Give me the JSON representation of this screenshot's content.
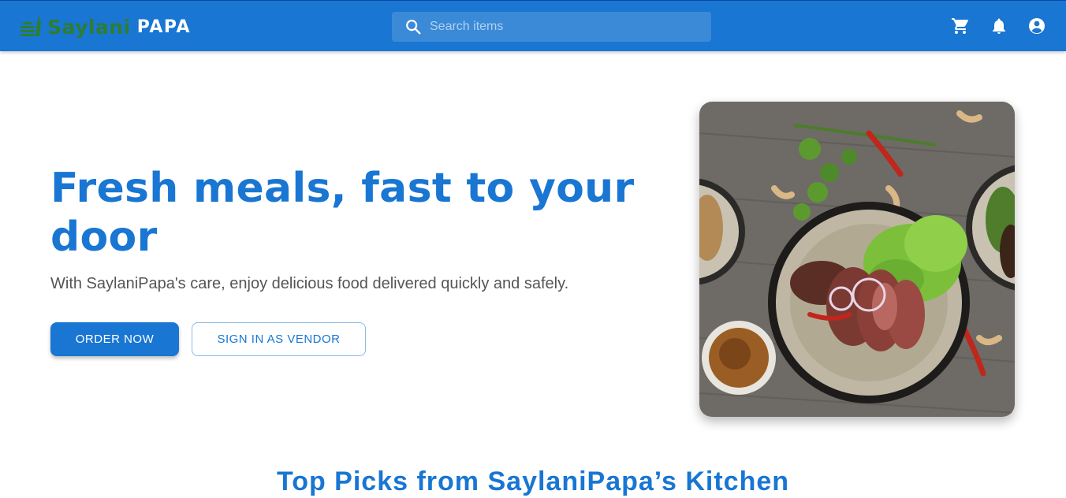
{
  "header": {
    "brand_name": "Saylani",
    "brand_suffix": "PAPA",
    "search_placeholder": "Search items",
    "icons": [
      "cart-icon",
      "notifications-icon",
      "account-icon"
    ],
    "colors": {
      "bar": "#1976d2",
      "brand_green": "#2e7d32"
    }
  },
  "hero": {
    "title": "Fresh meals, fast to your door",
    "subtitle": "With SaylaniPapa's care, enjoy delicious food delivered quickly and safely.",
    "primary_button": "ORDER NOW",
    "secondary_button": "SIGN IN AS VENDOR"
  },
  "section": {
    "title": "Top Picks from SaylaniPapa’s Kitchen"
  }
}
